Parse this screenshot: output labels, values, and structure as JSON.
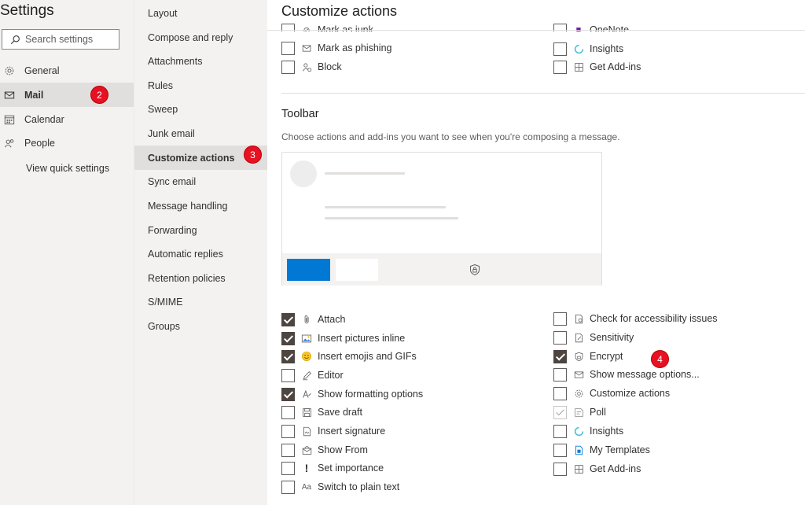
{
  "left_nav": {
    "title": "Settings",
    "search_placeholder": "Search settings",
    "items": [
      {
        "label": "General",
        "icon": "gear-icon"
      },
      {
        "label": "Mail",
        "icon": "mail-icon"
      },
      {
        "label": "Calendar",
        "icon": "calendar-icon"
      },
      {
        "label": "People",
        "icon": "people-icon"
      }
    ],
    "selected": "Mail",
    "view_quick_settings": "View quick settings"
  },
  "sub_nav": {
    "items": [
      "Layout",
      "Compose and reply",
      "Attachments",
      "Rules",
      "Sweep",
      "Junk email",
      "Customize actions",
      "Sync email",
      "Message handling",
      "Forwarding",
      "Automatic replies",
      "Retention policies",
      "S/MIME",
      "Groups"
    ],
    "selected": "Customize actions"
  },
  "main": {
    "title": "Customize actions",
    "clipped_top": [
      {
        "label": "Mark as junk",
        "checked": false,
        "icon": "junk-icon"
      },
      {
        "label": "OneNote",
        "checked": false,
        "icon": "onenote-icon"
      }
    ],
    "message_surface_left": [
      {
        "label": "Mark as phishing",
        "checked": false,
        "icon": "phishing-icon"
      },
      {
        "label": "Block",
        "checked": false,
        "icon": "block-user-icon"
      }
    ],
    "message_surface_right": [
      {
        "label": "Insights",
        "checked": false,
        "icon": "insights-icon"
      },
      {
        "label": "Get Add-ins",
        "checked": false,
        "icon": "add-ins-icon"
      }
    ],
    "toolbar": {
      "title": "Toolbar",
      "description": "Choose actions and add-ins you want to see when you're composing a message.",
      "left": [
        {
          "label": "Attach",
          "checked": true,
          "icon": "paperclip-icon"
        },
        {
          "label": "Insert pictures inline",
          "checked": true,
          "icon": "picture-icon"
        },
        {
          "label": "Insert emojis and GIFs",
          "checked": true,
          "icon": "emoji-icon"
        },
        {
          "label": "Editor",
          "checked": false,
          "icon": "editor-pen-icon"
        },
        {
          "label": "Show formatting options",
          "checked": true,
          "icon": "formatting-icon"
        },
        {
          "label": "Save draft",
          "checked": false,
          "icon": "save-icon"
        },
        {
          "label": "Insert signature",
          "checked": false,
          "icon": "signature-icon"
        },
        {
          "label": "Show From",
          "checked": false,
          "icon": "show-from-icon"
        },
        {
          "label": "Set importance",
          "checked": false,
          "icon": "importance-icon"
        },
        {
          "label": "Switch to plain text",
          "checked": false,
          "icon": "plain-text-icon"
        }
      ],
      "right": [
        {
          "label": "Check for accessibility issues",
          "checked": false,
          "icon": "accessibility-icon"
        },
        {
          "label": "Sensitivity",
          "checked": false,
          "icon": "sensitivity-icon"
        },
        {
          "label": "Encrypt",
          "checked": true,
          "icon": "encrypt-shield-icon"
        },
        {
          "label": "Show message options...",
          "checked": false,
          "icon": "message-options-icon"
        },
        {
          "label": "Customize actions",
          "checked": false,
          "icon": "gear-icon"
        },
        {
          "label": "Poll",
          "checked": "disabled",
          "icon": "poll-icon"
        },
        {
          "label": "Insights",
          "checked": false,
          "icon": "insights-icon"
        },
        {
          "label": "My Templates",
          "checked": false,
          "icon": "templates-icon"
        },
        {
          "label": "Get Add-ins",
          "checked": false,
          "icon": "add-ins-icon"
        }
      ]
    }
  },
  "badges": [
    "2",
    "3",
    "4"
  ],
  "colors": {
    "accent": "#0078d4",
    "checkbox_checked": "#4d4540",
    "badge": "#e81123",
    "nav_bg": "#f3f2f1",
    "selected_bg": "#e1dfdd"
  }
}
